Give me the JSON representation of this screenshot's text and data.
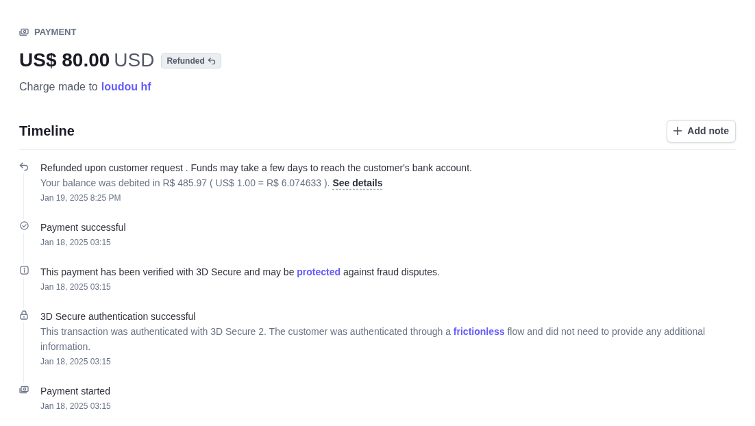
{
  "header": {
    "label": "PAYMENT",
    "amount": "US$ 80.00",
    "currency": "USD",
    "status": {
      "label": "Refunded",
      "kind": "refunded"
    },
    "charge_prefix": "Charge made to",
    "customer": "loudou hf"
  },
  "timeline": {
    "title": "Timeline",
    "add_button": "Add note",
    "events": [
      {
        "kind": "refund",
        "title": [
          {
            "kind": "text",
            "text": "Refunded upon customer request . Funds may take a few days to reach the customer's bank account."
          }
        ],
        "detail": [
          {
            "kind": "text",
            "text": "Your balance was debited in R$ 485.97 ( US$ 1.00 = R$ 6.074633 ). "
          },
          {
            "kind": "details",
            "text": "See details"
          }
        ],
        "time": "Jan 19, 2025 8:25 PM"
      },
      {
        "kind": "check",
        "title": [
          {
            "kind": "text",
            "text": "Payment successful"
          }
        ],
        "time": "Jan 18, 2025 03:15"
      },
      {
        "kind": "info",
        "title": [
          {
            "kind": "text",
            "text": "This payment has been verified with 3D Secure and may be "
          },
          {
            "kind": "link",
            "text": "protected"
          },
          {
            "kind": "text",
            "text": " against fraud disputes."
          }
        ],
        "time": "Jan 18, 2025 03:15"
      },
      {
        "kind": "lock",
        "title": [
          {
            "kind": "text",
            "text": "3D Secure authentication successful"
          }
        ],
        "detail": [
          {
            "kind": "text",
            "text": "This transaction was authenticated with 3D Secure 2. The customer was authenticated through a "
          },
          {
            "kind": "link",
            "text": "frictionless"
          },
          {
            "kind": "text",
            "text": " flow and did not need to provide any additional information."
          }
        ],
        "time": "Jan 18, 2025 03:15"
      },
      {
        "kind": "money",
        "title": [
          {
            "kind": "text",
            "text": "Payment started"
          }
        ],
        "time": "Jan 18, 2025 03:15"
      }
    ]
  }
}
